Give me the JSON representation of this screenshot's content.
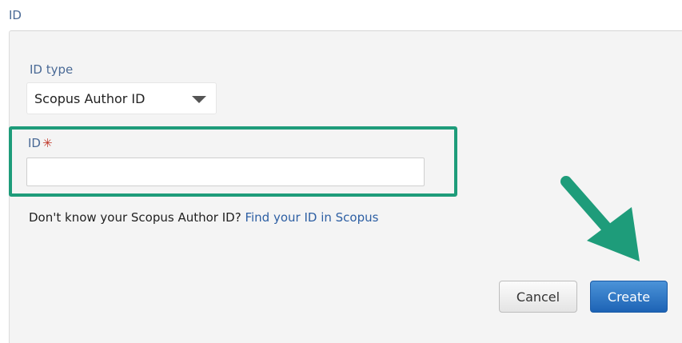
{
  "section": {
    "title": "ID"
  },
  "form": {
    "id_type_label": "ID type",
    "id_type_value": "Scopus Author ID",
    "id_label": "ID",
    "required_marker": "✳",
    "id_value": "",
    "id_placeholder": ""
  },
  "help": {
    "question": "Don't know your Scopus Author ID?",
    "link_text": "Find your ID in Scopus"
  },
  "buttons": {
    "cancel": "Cancel",
    "create": "Create"
  },
  "annotations": {
    "highlight_color": "#1e9c7a",
    "arrow_color": "#1e9c7a",
    "arrow_icon": "arrow-down-right-icon"
  },
  "colors": {
    "label": "#4a6a96",
    "link": "#2d5fa3",
    "primary_button": "#1d63b5",
    "required": "#c0392b"
  }
}
